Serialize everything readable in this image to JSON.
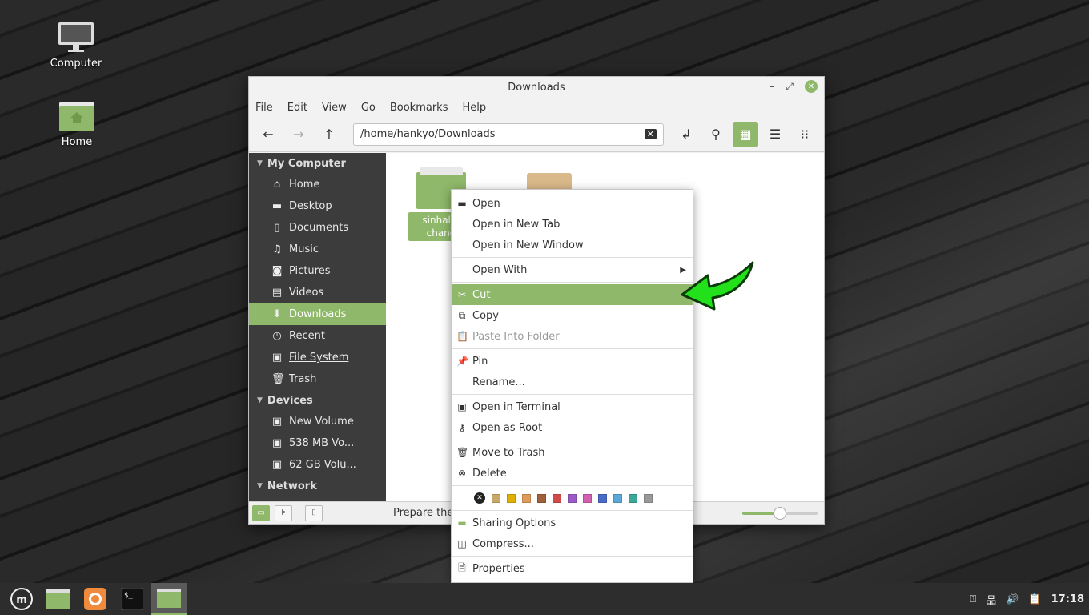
{
  "desktop": {
    "icons": [
      {
        "label": "Computer",
        "icon": "computer-icon"
      },
      {
        "label": "Home",
        "icon": "home-folder-icon"
      }
    ]
  },
  "window": {
    "title": "Downloads",
    "menu": [
      "File",
      "Edit",
      "Go",
      "Bookmarks",
      "Help"
    ],
    "location": "/home/hankyo/Downloads",
    "sidebar": {
      "sections": [
        {
          "title": "My Computer",
          "items": [
            {
              "label": "Home",
              "icon": "home-icon"
            },
            {
              "label": "Desktop",
              "icon": "desktop-icon"
            },
            {
              "label": "Documents",
              "icon": "document-icon"
            },
            {
              "label": "Music",
              "icon": "music-icon"
            },
            {
              "label": "Pictures",
              "icon": "camera-icon"
            },
            {
              "label": "Videos",
              "icon": "film-icon"
            },
            {
              "label": "Downloads",
              "icon": "download-icon"
            },
            {
              "label": "Recent",
              "icon": "clock-icon"
            },
            {
              "label": "File System",
              "icon": "drive-icon"
            },
            {
              "label": "Trash",
              "icon": "trash-icon"
            }
          ]
        },
        {
          "title": "Devices",
          "items": [
            {
              "label": "New Volume",
              "icon": "drive-icon"
            },
            {
              "label": "538 MB Vo...",
              "icon": "drive-icon"
            },
            {
              "label": "62 GB Volu...",
              "icon": "drive-icon"
            }
          ]
        },
        {
          "title": "Network",
          "items": []
        }
      ]
    },
    "files": [
      {
        "name": "sinhala-\nchang",
        "type": "folder"
      },
      {
        "name": "",
        "type": "package"
      }
    ],
    "status_text": "Prepare the s",
    "zoom_level": 0.5
  },
  "context_menu": {
    "items": [
      {
        "label": "Open",
        "icon": "folder-open-icon"
      },
      {
        "label": "Open in New Tab",
        "icon": ""
      },
      {
        "label": "Open in New Window",
        "icon": ""
      },
      {
        "label": "Open With",
        "icon": ""
      },
      {
        "label": "Cut",
        "icon": "scissors-icon"
      },
      {
        "label": "Copy",
        "icon": "copy-icon"
      },
      {
        "label": "Paste Into Folder",
        "icon": "clipboard-icon"
      },
      {
        "label": "Pin",
        "icon": "pin-icon"
      },
      {
        "label": "Rename...",
        "icon": ""
      },
      {
        "label": "Open in Terminal",
        "icon": "terminal-icon"
      },
      {
        "label": "Open as Root",
        "icon": "key-icon"
      },
      {
        "label": "Move to Trash",
        "icon": "trash-icon"
      },
      {
        "label": "Delete",
        "icon": "delete-icon"
      },
      {
        "label": "Sharing Options",
        "icon": "share-icon"
      },
      {
        "label": "Compress...",
        "icon": "archive-icon"
      },
      {
        "label": "Properties",
        "icon": "properties-icon"
      }
    ],
    "colors": [
      "#c8a86a",
      "#e0b000",
      "#e09a5a",
      "#a0603c",
      "#d04a4a",
      "#9a5ac8",
      "#d060b0",
      "#4a6ac8",
      "#5aa8d8",
      "#3aa898",
      "#999999"
    ]
  },
  "taskbar": {
    "apps": [
      "mint-menu-icon",
      "files-icon",
      "firefox-icon",
      "terminal-icon",
      "files-active-icon"
    ],
    "clock": "17:18"
  },
  "colors": {
    "accent": "#8fb86a",
    "sidebar_bg": "#3c3c3c",
    "taskbar_bg": "#2d2d2d"
  }
}
